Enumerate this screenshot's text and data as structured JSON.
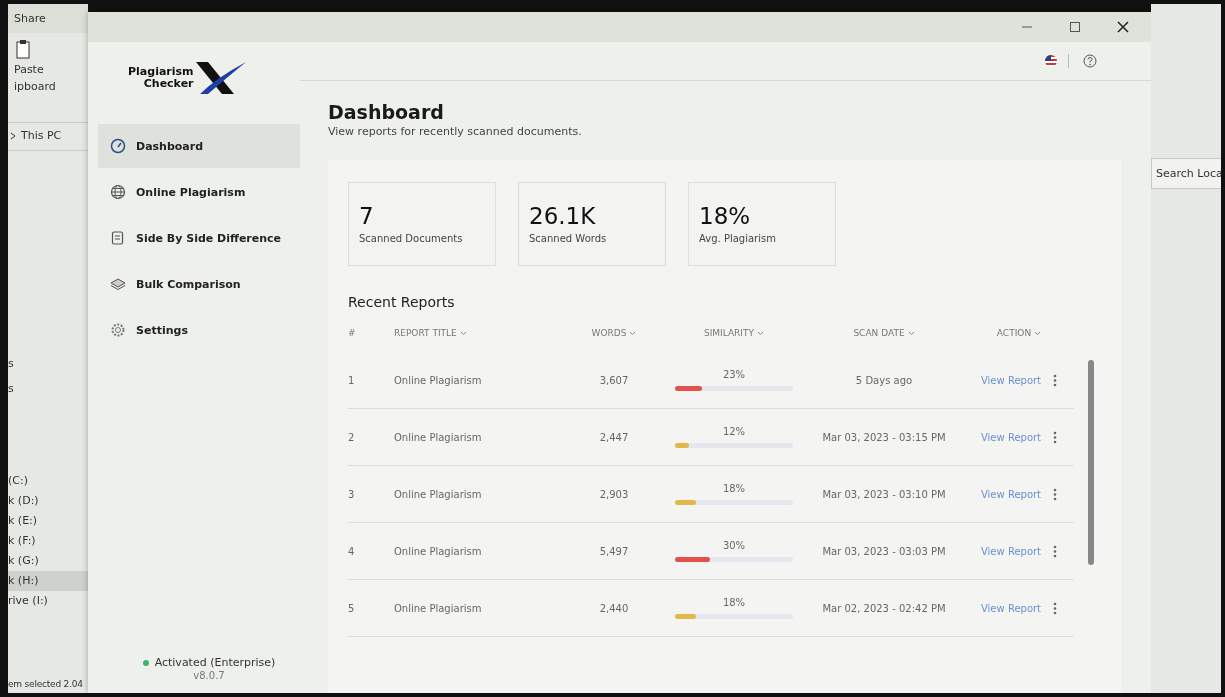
{
  "explorer_left": {
    "ribbon_tab": "Share",
    "paste_label": "Paste",
    "group_label": "ipboard",
    "breadcrumb": "This PC",
    "nav_items": [
      {
        "label": "s",
        "selected": false
      },
      {
        "label": "s",
        "selected": false
      },
      {
        "label": "(C:)",
        "selected": false
      },
      {
        "label": "k (D:)",
        "selected": false
      },
      {
        "label": "k (E:)",
        "selected": false
      },
      {
        "label": "k (F:)",
        "selected": false
      },
      {
        "label": "k (G:)",
        "selected": false
      },
      {
        "label": "k (H:)",
        "selected": true
      },
      {
        "label": "rive (I:)",
        "selected": false
      }
    ],
    "status_bar": "em selected 2.04"
  },
  "explorer_right": {
    "search_placeholder": "Search Loca"
  },
  "sidebar": {
    "logo": {
      "line1": "Plagiarism",
      "line2": "Checker"
    },
    "items": [
      {
        "label": "Dashboard",
        "selected": true
      },
      {
        "label": "Online Plagiarism",
        "selected": false
      },
      {
        "label": "Side By Side Difference",
        "selected": false
      },
      {
        "label": "Bulk Comparison",
        "selected": false
      },
      {
        "label": "Settings",
        "selected": false
      }
    ],
    "activation": {
      "label": "Activated (Enterprise)",
      "color": "#3fb36b"
    },
    "version": "v8.0.7"
  },
  "header": {
    "title": "Dashboard",
    "subtitle": "View reports for recently scanned documents."
  },
  "stats": [
    {
      "value": "7",
      "label": "Scanned Documents"
    },
    {
      "value": "26.1K",
      "label": "Scanned Words"
    },
    {
      "value": "18%",
      "label": "Avg. Plagiarism"
    }
  ],
  "recent_reports": {
    "title": "Recent Reports",
    "columns": [
      "#",
      "REPORT TITLE",
      "WORDS",
      "SIMILARITY",
      "SCAN DATE",
      "ACTION"
    ],
    "rows": [
      {
        "index": "1",
        "title": "Online Plagiarism",
        "words": "3,607",
        "similarity": "23%",
        "level": 0.23,
        "color": "#e0524a",
        "scan_date": "5 Days ago",
        "action": "View Report"
      },
      {
        "index": "2",
        "title": "Online Plagiarism",
        "words": "2,447",
        "similarity": "12%",
        "level": 0.12,
        "color": "#e2b84a",
        "scan_date": "Mar 03, 2023 - 03:15 PM",
        "action": "View Report"
      },
      {
        "index": "3",
        "title": "Online Plagiarism",
        "words": "2,903",
        "similarity": "18%",
        "level": 0.18,
        "color": "#e2b84a",
        "scan_date": "Mar 03, 2023 - 03:10 PM",
        "action": "View Report"
      },
      {
        "index": "4",
        "title": "Online Plagiarism",
        "words": "5,497",
        "similarity": "30%",
        "level": 0.3,
        "color": "#e0524a",
        "scan_date": "Mar 03, 2023 - 03:03 PM",
        "action": "View Report"
      },
      {
        "index": "5",
        "title": "Online Plagiarism",
        "words": "2,440",
        "similarity": "18%",
        "level": 0.18,
        "color": "#e2b84a",
        "scan_date": "Mar 02, 2023 - 02:42 PM",
        "action": "View Report"
      }
    ]
  }
}
